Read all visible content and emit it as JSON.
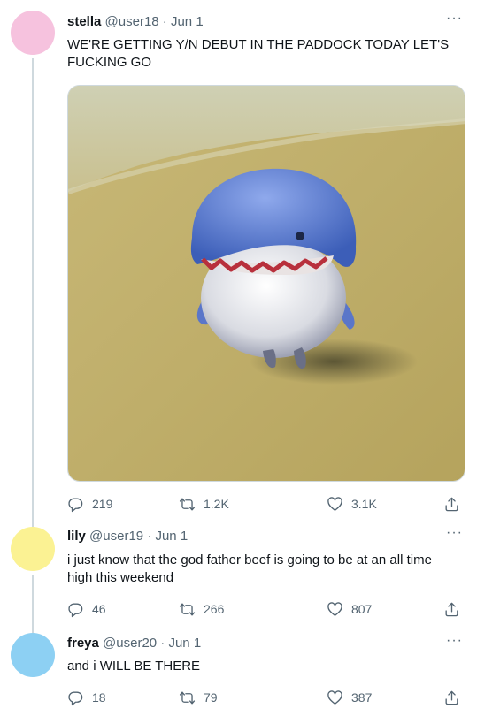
{
  "colors": {
    "avatar_stella": "#f6c2de",
    "avatar_lily": "#fbf293",
    "avatar_freya": "#8dd0f3",
    "secondary_text": "#536471",
    "thread_line": "#cfd9de"
  },
  "tweets": [
    {
      "name": "stella",
      "handle": "@user18",
      "separator": "·",
      "date": "Jun 1",
      "text": "WE'RE GETTING Y/N DEBUT IN THE PADDOCK TODAY LET'S FUCKING GO",
      "more": "···",
      "stats": {
        "replies": "219",
        "retweets": "1.2K",
        "likes": "3.1K"
      }
    },
    {
      "name": "lily",
      "handle": "@user19",
      "separator": "·",
      "date": "Jun 1",
      "text": "i just know that the god father beef is going to be at an all time high this weekend",
      "more": "···",
      "stats": {
        "replies": "46",
        "retweets": "266",
        "likes": "807"
      }
    },
    {
      "name": "freya",
      "handle": "@user20",
      "separator": "·",
      "date": "Jun 1",
      "text": "and i WILL BE THERE",
      "more": "···",
      "stats": {
        "replies": "18",
        "retweets": "79",
        "likes": "387"
      }
    }
  ],
  "icons": {
    "reply": "reply-icon",
    "retweet": "retweet-icon",
    "like": "heart-icon",
    "share": "share-icon",
    "more": "more-icon"
  }
}
